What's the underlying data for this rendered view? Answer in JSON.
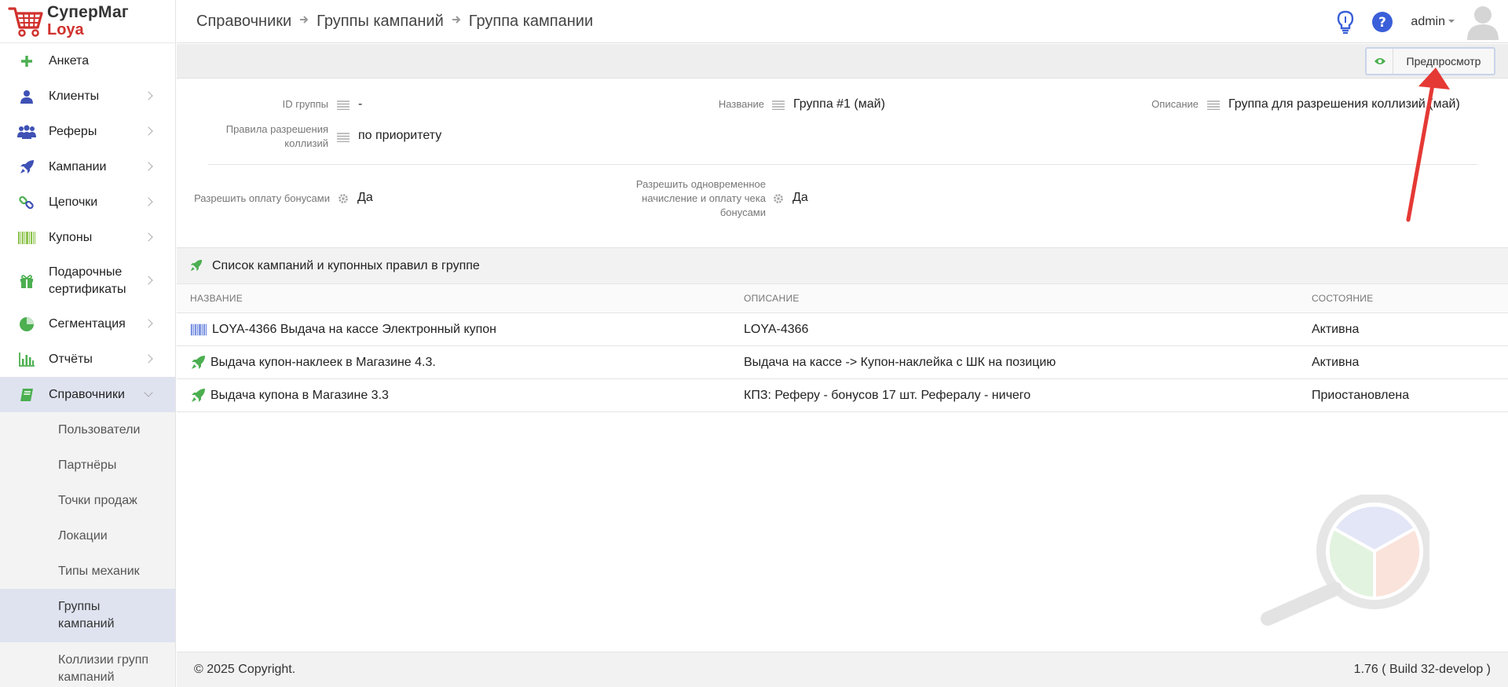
{
  "app": {
    "logo_line1": "СуперМаг",
    "logo_line2": "Loya"
  },
  "sidebar": {
    "items": [
      {
        "label": "Анкета",
        "icon": "plus-icon",
        "has_arrow": false
      },
      {
        "label": "Клиенты",
        "icon": "user-icon",
        "has_arrow": true
      },
      {
        "label": "Реферы",
        "icon": "users-icon",
        "has_arrow": true
      },
      {
        "label": "Кампании",
        "icon": "rocket-icon",
        "has_arrow": true
      },
      {
        "label": "Цепочки",
        "icon": "link-icon",
        "has_arrow": true
      },
      {
        "label": "Купоны",
        "icon": "barcode-icon",
        "has_arrow": true
      },
      {
        "label": "Подарочные сертификаты",
        "icon": "gift-icon",
        "has_arrow": true
      },
      {
        "label": "Сегментация",
        "icon": "pie-icon",
        "has_arrow": true
      },
      {
        "label": "Отчёты",
        "icon": "bar-chart-icon",
        "has_arrow": true
      },
      {
        "label": "Справочники",
        "icon": "book-icon",
        "has_arrow": true,
        "open": true
      }
    ],
    "sub_items": [
      {
        "label": "Пользователи"
      },
      {
        "label": "Партнёры"
      },
      {
        "label": "Точки продаж"
      },
      {
        "label": "Локации"
      },
      {
        "label": "Типы механик"
      },
      {
        "label": "Группы кампаний",
        "active": true
      },
      {
        "label": "Коллизии групп кампаний"
      }
    ]
  },
  "header": {
    "breadcrumbs": [
      "Справочники",
      "Группы кампаний",
      "Группа кампании"
    ],
    "user": "admin"
  },
  "toolbar": {
    "preview_label": "Предпросмотр"
  },
  "form": {
    "group_id_label": "ID группы",
    "group_id_value": "-",
    "name_label": "Название",
    "name_value": "Группа #1 (май)",
    "description_label": "Описание",
    "description_value": "Группа для разрешения коллизий (май)",
    "collision_rules_label": "Правила разрешения коллизий",
    "collision_rules_value": "по приоритету",
    "allow_bonus_payment_label": "Разрешить оплату бонусами",
    "allow_bonus_payment_value": "Да",
    "allow_simultaneous_label": "Разрешить одновременное начисление и оплату чека бонусами",
    "allow_simultaneous_value": "Да"
  },
  "section": {
    "title": "Список кампаний и купонных правил в группе"
  },
  "table": {
    "columns": [
      "НАЗВАНИЕ",
      "ОПИСАНИЕ",
      "СОСТОЯНИЕ"
    ],
    "rows": [
      {
        "icon": "barcode-icon",
        "name": "LOYA-4366 Выдача на кассе Электронный купон",
        "description": "LOYA-4366",
        "status": "Активна"
      },
      {
        "icon": "rocket-icon",
        "name": "Выдача купон-наклеек в Магазине 4.3.",
        "description": "Выдача на кассе -> Купон-наклейка с ШК на позицию",
        "status": "Активна"
      },
      {
        "icon": "rocket-icon",
        "name": "Выдача купона в Магазине 3.3",
        "description": "КПЗ: Реферу - бонусов 17 шт. Рефералу - ничего",
        "status": "Приостановлена"
      }
    ]
  },
  "footer": {
    "copyright": "© 2025 Copyright.",
    "version": "1.76 ( Build 32-develop )"
  },
  "colors": {
    "brand_red": "#d0312d",
    "icon_green": "#4caf50",
    "icon_blue": "#3f51b5",
    "active_bg": "#dfe3f0",
    "annotation_red": "#e53935"
  }
}
